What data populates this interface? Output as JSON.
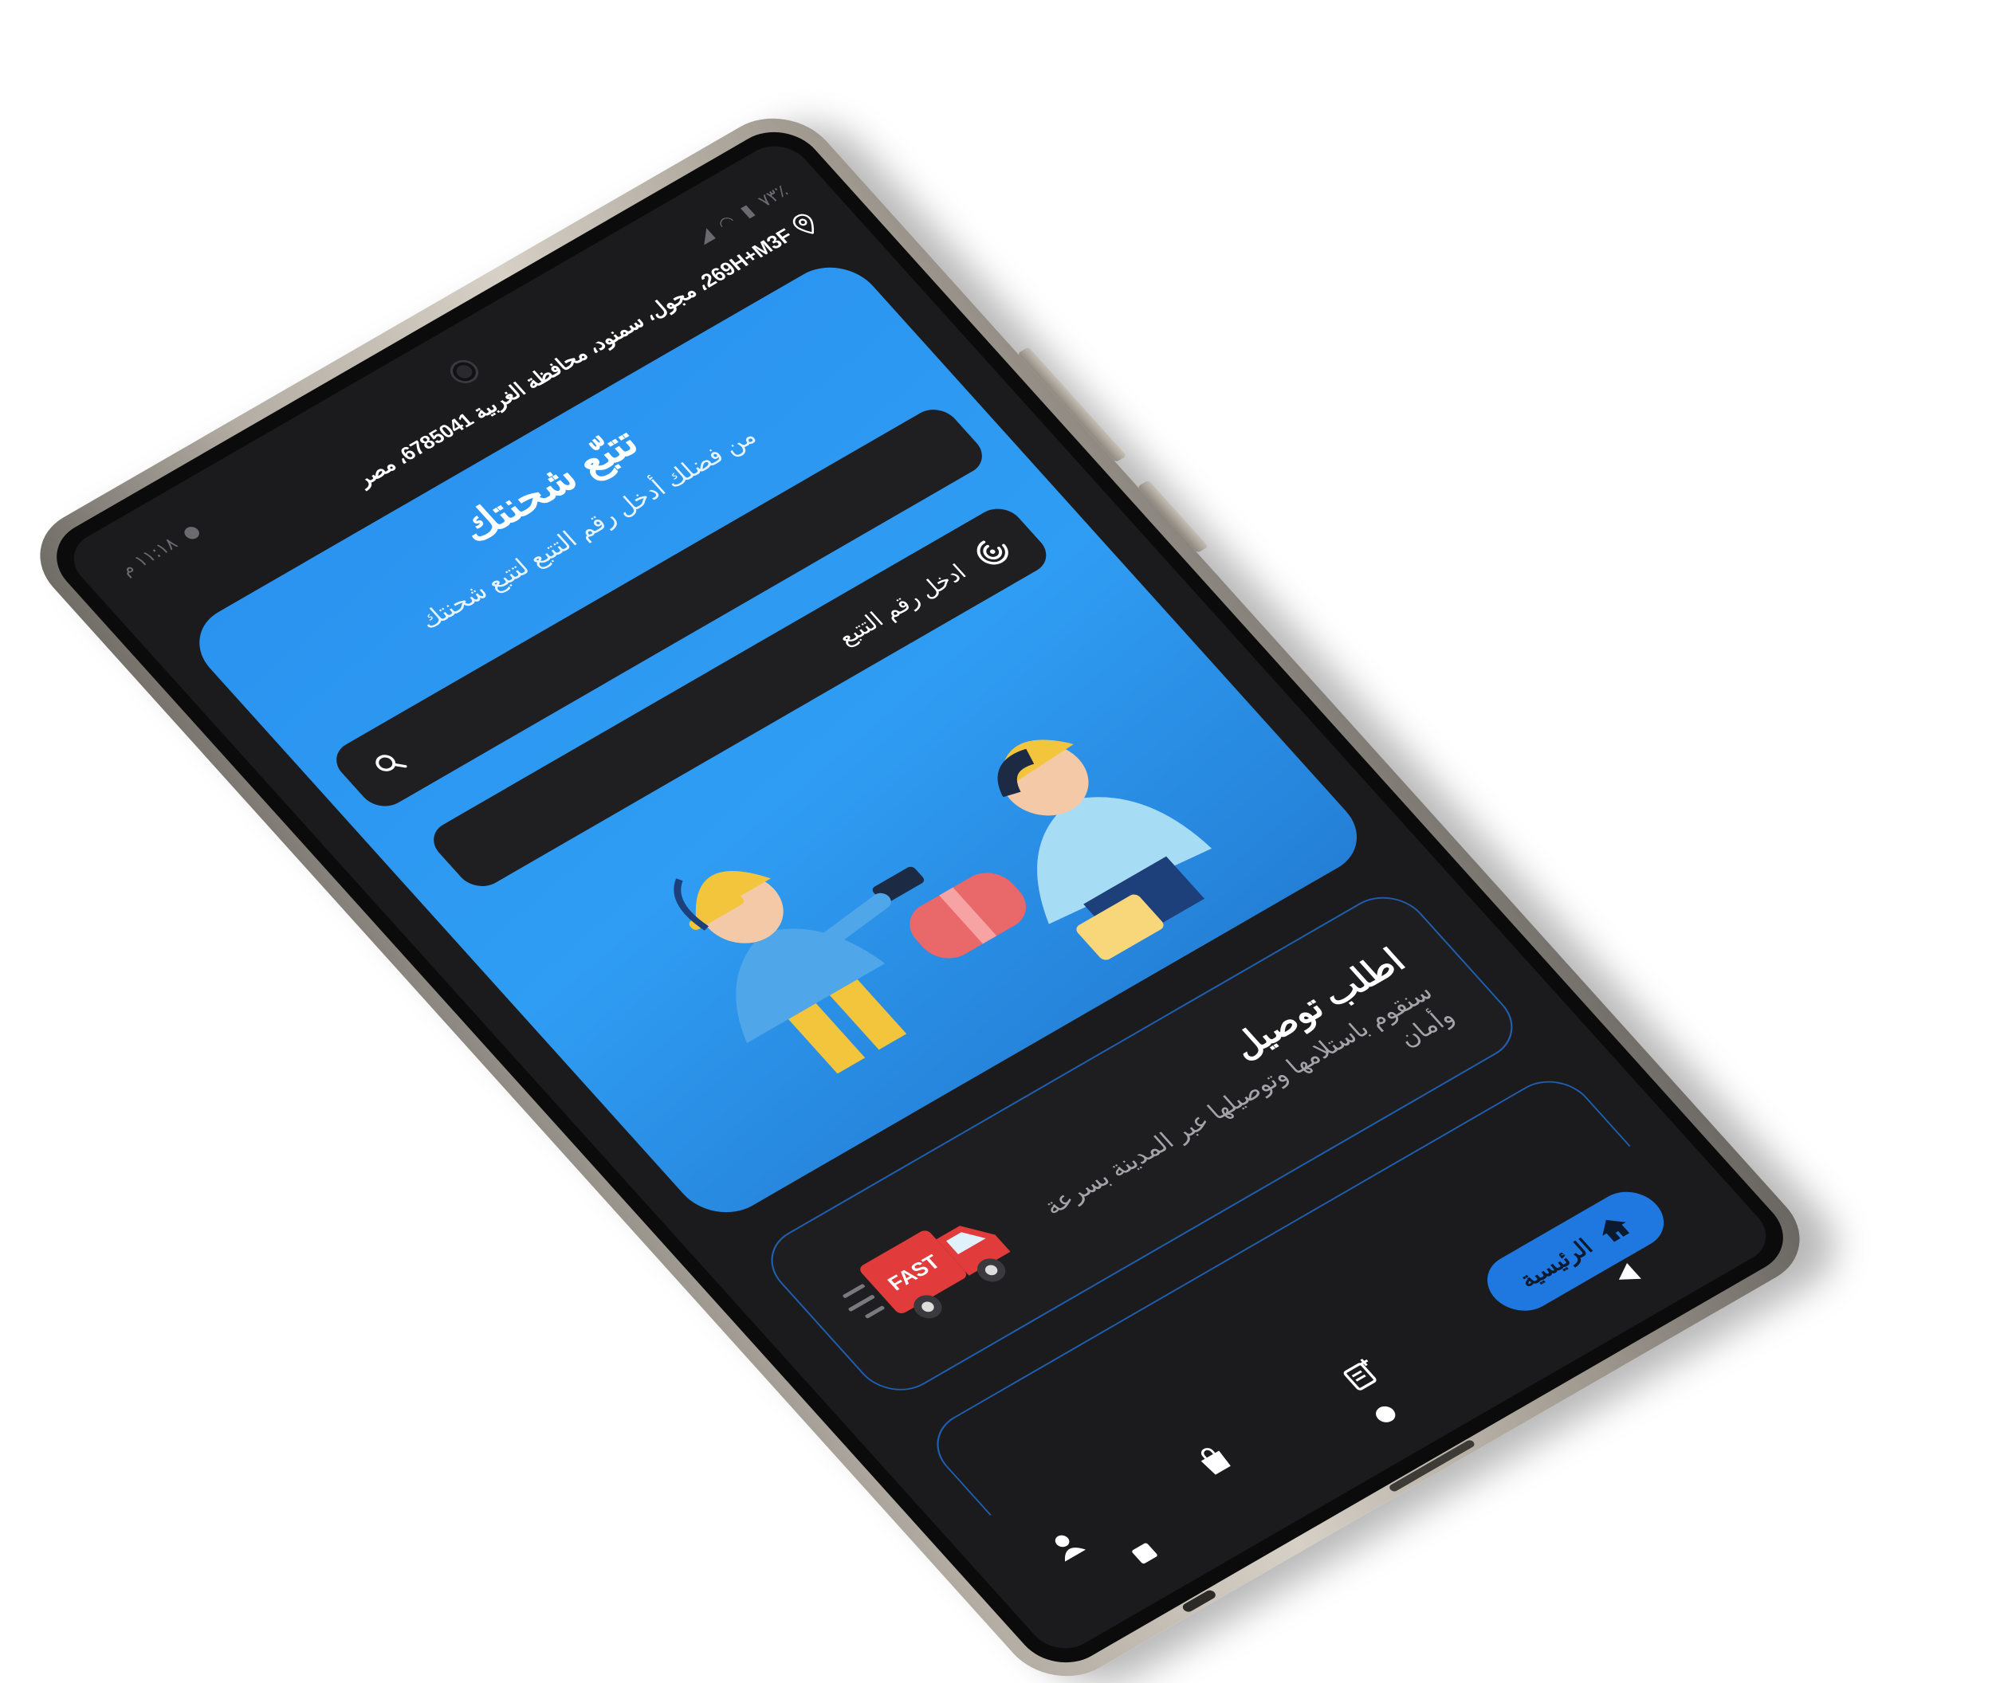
{
  "status_bar": {
    "time": "١١:١٨ م",
    "battery": "٧٣٪"
  },
  "location": {
    "address": "269H+M3F، مجول، سمنود، محافظة الغربية 6785041، مصر"
  },
  "hero": {
    "title": "تتبّع شحنتك",
    "subtitle": "من فضلك أدخل رقم التتبع لتتبع شحنتك"
  },
  "search": {
    "value": ""
  },
  "scan": {
    "label": "ادخل رقم التتبع"
  },
  "delivery": {
    "title": "اطلب توصيل",
    "description": "سنقوم باستلامها وتوصيلها عبر المدينة بسرعة وأمان",
    "badge_text": "FAST"
  },
  "bottom_nav": {
    "home_label": "الرئيسية"
  },
  "colors": {
    "accent": "#2a93f0",
    "screen_bg": "#1b1b1d",
    "card_border": "#1e5fb0"
  },
  "icons": [
    "location-pin-icon",
    "search-icon",
    "scan-icon",
    "home-icon",
    "add-note-icon",
    "shopping-bag-icon",
    "person-icon",
    "back-triangle-icon",
    "home-circle-icon",
    "recent-square-icon"
  ]
}
